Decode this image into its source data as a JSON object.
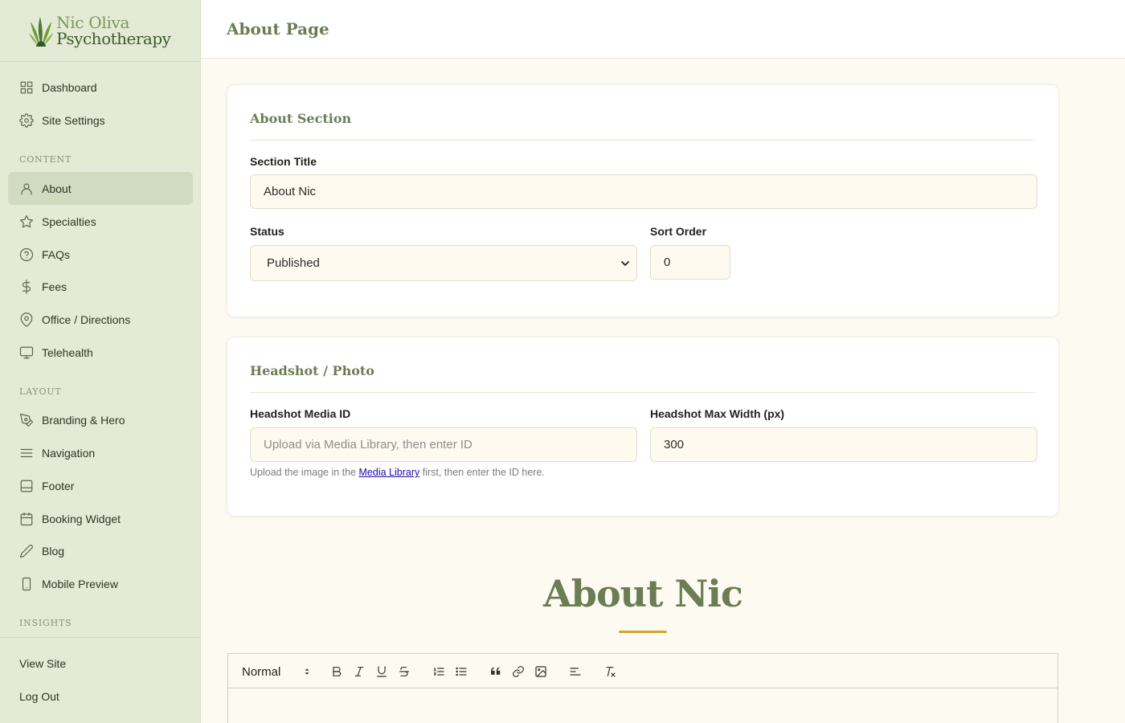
{
  "brand": {
    "line1": "Nic Oliva",
    "line2": "Psychotherapy"
  },
  "sidebar": {
    "top_items": [
      {
        "label": "Dashboard",
        "icon": "grid-icon"
      },
      {
        "label": "Site Settings",
        "icon": "gear-icon"
      }
    ],
    "content_heading": "CONTENT",
    "content_items": [
      {
        "label": "About",
        "icon": "user-icon",
        "active": true
      },
      {
        "label": "Specialties",
        "icon": "star-icon"
      },
      {
        "label": "FAQs",
        "icon": "question-circle-icon"
      },
      {
        "label": "Fees",
        "icon": "dollar-icon"
      },
      {
        "label": "Office / Directions",
        "icon": "map-pin-icon"
      },
      {
        "label": "Telehealth",
        "icon": "monitor-icon"
      }
    ],
    "layout_heading": "LAYOUT",
    "layout_items": [
      {
        "label": "Branding & Hero",
        "icon": "pen-tool-icon"
      },
      {
        "label": "Navigation",
        "icon": "menu-icon"
      },
      {
        "label": "Footer",
        "icon": "footer-panel-icon"
      },
      {
        "label": "Booking Widget",
        "icon": "calendar-icon"
      },
      {
        "label": "Blog",
        "icon": "pencil-icon"
      },
      {
        "label": "Mobile Preview",
        "icon": "smartphone-icon"
      }
    ],
    "insights_heading": "INSIGHTS",
    "view_site": "View Site",
    "log_out": "Log Out"
  },
  "header": {
    "title": "About Page"
  },
  "about_section": {
    "title": "About Section",
    "section_title_label": "Section Title",
    "section_title_value": "About Nic",
    "status_label": "Status",
    "status_value": "Published",
    "sort_order_label": "Sort Order",
    "sort_order_value": "0"
  },
  "headshot_section": {
    "title": "Headshot / Photo",
    "media_id_label": "Headshot Media ID",
    "media_id_placeholder": "Upload via Media Library, then enter ID",
    "max_width_label": "Headshot Max Width (px)",
    "max_width_value": "300",
    "help_prefix": "Upload the image in the ",
    "help_link": "Media Library",
    "help_suffix": " first, then enter the ID here."
  },
  "preview": {
    "title": "About Nic"
  },
  "editor": {
    "format_value": "Normal"
  },
  "colors": {
    "accent": "#6b7d54",
    "sidebar_bg": "#e3ead6",
    "active_bg": "#d1dbbf",
    "gold": "#d4a52a",
    "page_bg": "#fdfaf1"
  }
}
